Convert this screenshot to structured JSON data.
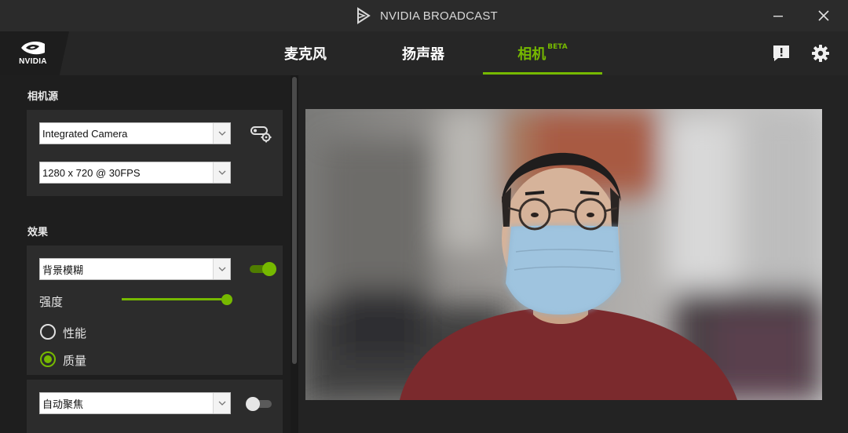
{
  "window": {
    "title": "NVIDIA BROADCAST",
    "logo_text": "NVIDIA"
  },
  "tabs": [
    {
      "label": "麦克风",
      "active": false
    },
    {
      "label": "扬声器",
      "active": false
    },
    {
      "label": "相机",
      "badge": "BETA",
      "active": true
    }
  ],
  "header_icons": [
    "feedback-icon",
    "gear-icon"
  ],
  "camera_source": {
    "label": "相机源",
    "device": "Integrated Camera",
    "resolution": "1280 x 720 @ 30FPS"
  },
  "effects": {
    "label": "效果",
    "effect1": {
      "name": "背景模糊",
      "enabled": true,
      "strength_label": "强度",
      "strength": 0.95,
      "options": [
        {
          "label": "性能",
          "selected": false
        },
        {
          "label": "质量",
          "selected": true
        }
      ]
    },
    "effect2": {
      "name": "自动聚焦",
      "enabled": false
    }
  },
  "colors": {
    "accent": "#76b900",
    "panel": "#2c2c2c",
    "background": "#1e1e1e"
  }
}
